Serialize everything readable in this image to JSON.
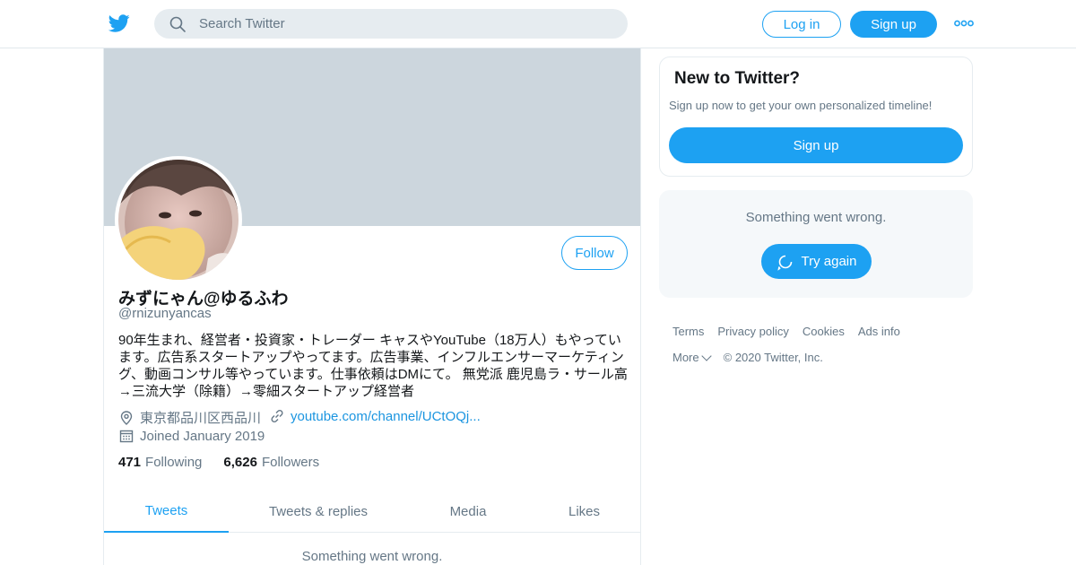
{
  "header": {
    "search_placeholder": "Search Twitter",
    "login_label": "Log in",
    "signup_label": "Sign up",
    "brand_color": "#1da1f2"
  },
  "profile": {
    "display_name": "みずにゃん@ゆるふわ",
    "handle": "@rnizunyancas",
    "follow_label": "Follow",
    "bio": "90年生まれ、経営者・投資家・トレーダー キャスやYouTube（18万人）もやっています。広告系スタートアップやってます。広告事業、インフルエンサーマーケティング、動画コンサル等やっています。仕事依頼はDMにて。 無党派 鹿児島ラ・サール高→三流大学（除籍）→零細スタートアップ経営者",
    "location": "東京都品川区西品川",
    "link": "youtube.com/channel/UCtOQj...",
    "joined": "Joined January 2019",
    "following_count": "471",
    "following_label": "Following",
    "followers_count": "6,626",
    "followers_label": "Followers",
    "tabs": [
      {
        "label": "Tweets",
        "active": true
      },
      {
        "label": "Tweets & replies",
        "active": false
      },
      {
        "label": "Media",
        "active": false
      },
      {
        "label": "Likes",
        "active": false
      }
    ],
    "error_text": "Something went wrong."
  },
  "sidebar": {
    "new_title": "New to Twitter?",
    "new_sub": "Sign up now to get your own personalized timeline!",
    "new_btn": "Sign up",
    "wrong_text": "Something went wrong.",
    "retry_label": "Try again"
  },
  "footer": {
    "links": [
      "Terms",
      "Privacy policy",
      "Cookies",
      "Ads info"
    ],
    "more": "More",
    "copyright": "© 2020 Twitter, Inc."
  }
}
